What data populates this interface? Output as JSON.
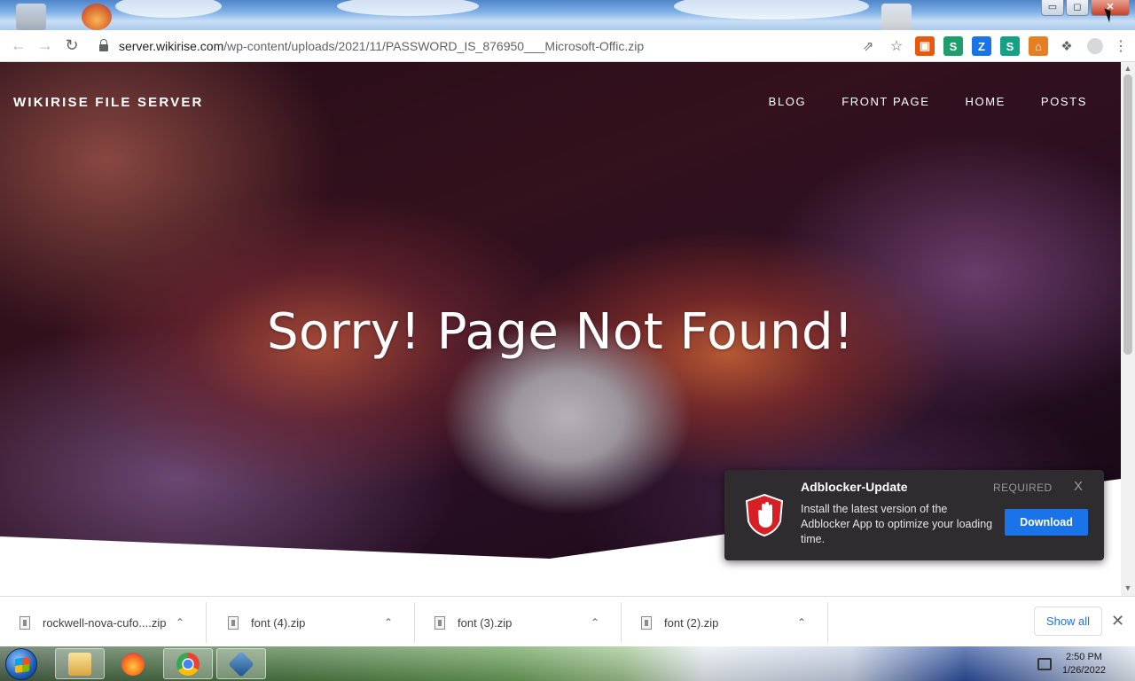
{
  "browser": {
    "url_host": "server.wikirise.com",
    "url_path": "/wp-content/uploads/2021/11/PASSWORD_IS_876950___Microsoft-Offic.zip",
    "window_controls": {
      "minimize": "▭",
      "maximize": "◻",
      "close": "✕"
    },
    "extensions": [
      {
        "icon": "orange-extension-icon",
        "color": "#e8590c",
        "glyph": "▣"
      },
      {
        "icon": "green-s-extension-icon",
        "color": "#1e9e6a",
        "glyph": "S"
      },
      {
        "icon": "blue-z-extension-icon",
        "color": "#1a73e8",
        "glyph": "Z"
      },
      {
        "icon": "teal-s-extension-icon",
        "color": "#16a085",
        "glyph": "S"
      },
      {
        "icon": "home-extension-icon",
        "color": "#e67e22",
        "glyph": "⌂"
      }
    ]
  },
  "site": {
    "title": "WIKIRISE FILE SERVER",
    "menu": [
      "BLOG",
      "FRONT PAGE",
      "HOME",
      "POSTS"
    ],
    "headline": "Sorry! Page Not Found!"
  },
  "notification": {
    "title": "Adblocker-Update",
    "tag": "REQUIRED",
    "close": "X",
    "body": "Install the latest version of the Adblocker App to optimize your loading time.",
    "button": "Download",
    "accent": "#1a73e8"
  },
  "downloads": {
    "items": [
      "rockwell-nova-cufo....zip",
      "font (4).zip",
      "font (3).zip",
      "font (2).zip"
    ],
    "show_all": "Show all"
  },
  "taskbar": {
    "time": "2:50 PM",
    "date": "1/26/2022"
  }
}
